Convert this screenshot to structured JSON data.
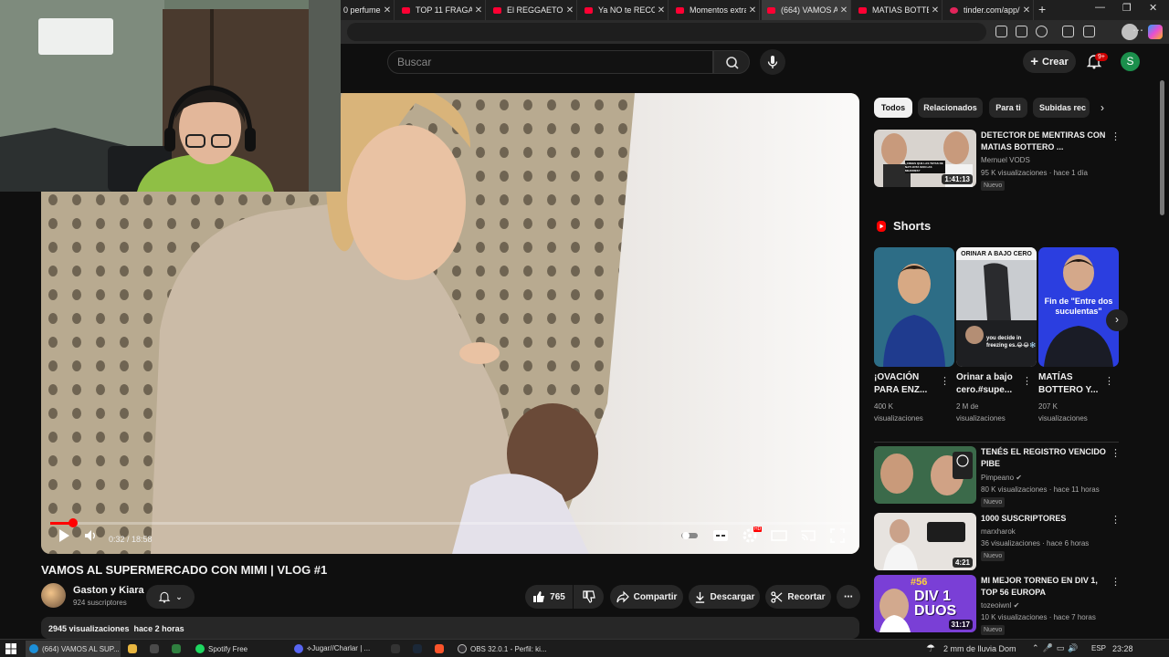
{
  "browser": {
    "tabs": [
      {
        "title": "0 perfumes",
        "icon": "youtube-icon"
      },
      {
        "title": "TOP 11 FRAGAN",
        "icon": "youtube-icon"
      },
      {
        "title": "El REGGAETON c",
        "icon": "youtube-icon"
      },
      {
        "title": "Ya NO te RECOM",
        "icon": "youtube-icon"
      },
      {
        "title": "Momentos extra",
        "icon": "youtube-icon"
      },
      {
        "title": "(664) VAMOS AL",
        "icon": "youtube-icon",
        "active": true
      },
      {
        "title": "MATIAS BOTTER",
        "icon": "youtube-icon"
      },
      {
        "title": "tinder.com/app/",
        "icon": "tinder-icon"
      }
    ]
  },
  "header": {
    "search_placeholder": "Buscar",
    "create_label": "Crear",
    "notifications_count": "9+",
    "user_initial": "S"
  },
  "player": {
    "time": "0:32 / 18:58",
    "progress_fraction": 0.028,
    "hd_badge": "HD"
  },
  "video": {
    "title": "VAMOS AL SUPERMERCADO CON MIMI | VLOG #1",
    "channel": "Gaston y Kiara",
    "subscribers": "924 suscriptores",
    "likes": "765",
    "share_label": "Compartir",
    "download_label": "Descargar",
    "clip_label": "Recortar",
    "views_line": "2945 visualizaciones  hace 2 horas"
  },
  "chips": [
    "Todos",
    "Relacionados",
    "Para ti",
    "Subidas rec"
  ],
  "related_top": {
    "title": "DETECTOR DE MENTIRAS CON MATIAS BOTTERO ...",
    "channel": "Mernuel VODS",
    "meta": "95 K visualizaciones · hace 1 día",
    "badge": "Nuevo",
    "duration": "1:41:13",
    "thumb_text": "¿CREES QUE LAS TETAS DE NATI JOTA SON LAS MEJORES?"
  },
  "shorts": {
    "heading": "Shorts",
    "items": [
      {
        "title": "¡OVACIÓN PARA ENZ...",
        "views": "400 K visualizaciones",
        "overlay": ""
      },
      {
        "title": "Orinar a bajo cero.#supe...",
        "views": "2 M de visualizaciones",
        "overlay": "ORINAR A BAJO CERO",
        "overlay2": "you decide in freezing es.😂😂❄️"
      },
      {
        "title": "MATÍAS BOTTERO Y...",
        "views": "207 K visualizaciones",
        "overlay": "Fin de \"Entre dos suculentas\""
      }
    ]
  },
  "related": [
    {
      "title": "TENÉS EL REGISTRO VENCIDO PIBE",
      "channel": "Pimpeano ✔",
      "meta": "80 K visualizaciones · hace 11 horas",
      "badge": "Nuevo",
      "duration": ""
    },
    {
      "title": "1000 SUSCRIPTORES",
      "channel": "marxharok",
      "meta": "36 visualizaciones · hace 6 horas",
      "badge": "Nuevo",
      "duration": "4:21"
    },
    {
      "title": "MI MEJOR TORNEO EN DIV 1, TOP 56 EUROPA",
      "channel": "tozeoiwnl ✔",
      "meta": "10 K visualizaciones · hace 7 horas",
      "badge": "Nuevo",
      "duration": "31:17",
      "thumb_text": "DIV 1 DUOS",
      "thumb_badge": "#56"
    }
  ],
  "taskbar": {
    "items": [
      "(664) VAMOS AL SUP...",
      "Spotify Free",
      "⟡Jugar//Charlar | ...",
      "OBS 32.0.1 - Perfil: ki..."
    ],
    "weather": "2 mm de lluvia Dom",
    "lang": "ESP",
    "clock": "23:28"
  },
  "colors": {
    "accent": "#ff0000",
    "background": "#0f0f0f",
    "chip": "#272727"
  }
}
